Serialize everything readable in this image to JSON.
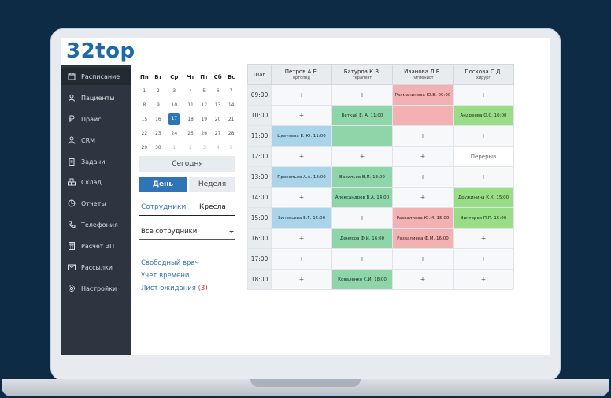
{
  "app": {
    "logo": "32top"
  },
  "sidebar": {
    "items": [
      {
        "label": "Расписание",
        "icon": "calendar-icon",
        "active": true
      },
      {
        "label": "Пациенты",
        "icon": "user-icon"
      },
      {
        "label": "Прайс",
        "icon": "ruble-icon"
      },
      {
        "label": "CRM",
        "icon": "person-icon"
      },
      {
        "label": "Задачи",
        "icon": "clipboard-icon"
      },
      {
        "label": "Склад",
        "icon": "boxes-icon"
      },
      {
        "label": "Отчеты",
        "icon": "pie-chart-icon"
      },
      {
        "label": "Телефония",
        "icon": "phone-icon"
      },
      {
        "label": "Расчет ЗП",
        "icon": "calculator-icon"
      },
      {
        "label": "Рассылки",
        "icon": "mail-icon"
      },
      {
        "label": "Настройки",
        "icon": "gear-icon"
      }
    ]
  },
  "calendar": {
    "weekdays": [
      "Пн",
      "Вт",
      "Ср",
      "Чт",
      "Пт",
      "Сб",
      "Вс"
    ],
    "weeks": [
      [
        "1",
        "2",
        "3",
        "4",
        "5",
        "6",
        "7"
      ],
      [
        "8",
        "9",
        "10",
        "11",
        "12",
        "13",
        "14"
      ],
      [
        "15",
        "16",
        "17",
        "18",
        "19",
        "20",
        "21"
      ],
      [
        "22",
        "23",
        "24",
        "25",
        "26",
        "27",
        "28"
      ],
      [
        "29",
        "30",
        "1",
        "2",
        "3",
        "4",
        "5"
      ]
    ],
    "selected": "17"
  },
  "controls": {
    "today": "Сегодня",
    "day": "День",
    "week": "Неделя",
    "tab_staff": "Сотрудники",
    "tab_chairs": "Кресла",
    "select_value": "Все сотрудники",
    "link_free_doctor": "Свободный врач",
    "link_time": "Учет времени",
    "link_waitlist": "Лист ожидания",
    "waitlist_count": "(3)"
  },
  "schedule": {
    "step_label": "Шаг",
    "doctors": [
      {
        "name": "Петров А.Е.",
        "spec": "ортопед"
      },
      {
        "name": "Батуров К.В.",
        "spec": "терапевт"
      },
      {
        "name": "Иванова Л.Б.",
        "spec": "гигиенист"
      },
      {
        "name": "Поскова С.Д.",
        "spec": "хирург"
      }
    ],
    "rows": [
      {
        "time": "09:00",
        "cells": [
          {
            "t": "+",
            "c": "plus"
          },
          {
            "t": "+",
            "c": "plus"
          },
          {
            "t": "Рахманинова Ю.В. 09:00",
            "c": "pink"
          },
          {
            "t": "+",
            "c": "plus"
          }
        ]
      },
      {
        "time": "10:00",
        "cells": [
          {
            "t": "+",
            "c": "plus"
          },
          {
            "t": "Веткий Е. А. 11:00",
            "c": "green"
          },
          {
            "t": "",
            "c": "pink"
          },
          {
            "t": "Андреева О.С. 10:00",
            "c": "lgreen"
          }
        ]
      },
      {
        "time": "11:00",
        "cells": [
          {
            "t": "Цветкова Е. Ю. 11:00",
            "c": "blue"
          },
          {
            "t": "",
            "c": "green"
          },
          {
            "t": "+",
            "c": "plus"
          },
          {
            "t": "+",
            "c": "plus"
          }
        ]
      },
      {
        "time": "12:00",
        "cells": [
          {
            "t": "+",
            "c": "plus"
          },
          {
            "t": "+",
            "c": "plus"
          },
          {
            "t": "+",
            "c": "plus"
          },
          {
            "t": "Перерыв",
            "c": "brk"
          }
        ]
      },
      {
        "time": "13:00",
        "cells": [
          {
            "t": "Прокопьев А.А. 13:00",
            "c": "blue"
          },
          {
            "t": "Васильев В.П. 13:00",
            "c": "green"
          },
          {
            "t": "+",
            "c": "plus"
          },
          {
            "t": "+",
            "c": "plus"
          }
        ]
      },
      {
        "time": "14:00",
        "cells": [
          {
            "t": "+",
            "c": "plus"
          },
          {
            "t": "Александров В.А. 14:00",
            "c": "green"
          },
          {
            "t": "+",
            "c": "plus"
          },
          {
            "t": "Дружинина К.К. 15:00",
            "c": "lgreen"
          }
        ]
      },
      {
        "time": "15:00",
        "cells": [
          {
            "t": "Зиновьева Е.Г. 15:00",
            "c": "blue"
          },
          {
            "t": "+",
            "c": "plus"
          },
          {
            "t": "Развалиева Ю.М. 15:00",
            "c": "pink"
          },
          {
            "t": "Викторов П.П. 15:00",
            "c": "lgreen"
          }
        ]
      },
      {
        "time": "16:00",
        "cells": [
          {
            "t": "+",
            "c": "plus"
          },
          {
            "t": "Денисов Ф.И. 16:00",
            "c": "green"
          },
          {
            "t": "Развалиева Ф.М. 16:00",
            "c": "pink"
          },
          {
            "t": "+",
            "c": "plus"
          }
        ]
      },
      {
        "time": "17:00",
        "cells": [
          {
            "t": "+",
            "c": "plus"
          },
          {
            "t": "+",
            "c": "plus"
          },
          {
            "t": "+",
            "c": "plus"
          },
          {
            "t": "+",
            "c": "plus"
          }
        ]
      },
      {
        "time": "18:00",
        "cells": [
          {
            "t": "+",
            "c": "plus"
          },
          {
            "t": "Коваленко С.И. 18:00",
            "c": "green"
          },
          {
            "t": "+",
            "c": "plus"
          },
          {
            "t": "+",
            "c": "plus"
          }
        ]
      }
    ]
  },
  "colors": {
    "accent": "#2f74b7",
    "sidebar": "#2d3640",
    "booked_green": "#8ed6a9",
    "booked_blue": "#a9d4ea",
    "booked_pink": "#f3b1b4",
    "booked_light_green": "#99dd87"
  }
}
